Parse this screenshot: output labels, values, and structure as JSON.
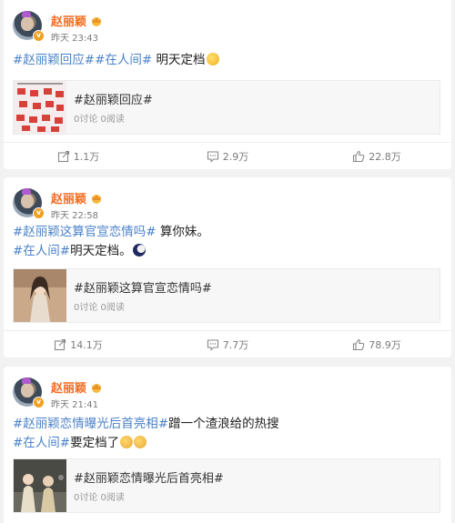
{
  "posts": [
    {
      "username": "赵丽颖",
      "time": "昨天 23:43",
      "lines": [
        [
          {
            "t": "#赵丽颖回应##在人间#",
            "tag": true
          },
          {
            "t": " 明天定档",
            "tag": false
          }
        ]
      ],
      "emoji_end": "yellow",
      "quote": {
        "title": "#赵丽颖回应#",
        "stats": "0讨论 0阅读"
      },
      "actions": {
        "repost": "1.1万",
        "comment": "2.9万",
        "like": "22.8万"
      }
    },
    {
      "username": "赵丽颖",
      "time": "昨天 22:58",
      "lines": [
        [
          {
            "t": "#赵丽颖这算官宣恋情吗#",
            "tag": true
          },
          {
            "t": " 算你妹。",
            "tag": false
          }
        ],
        [
          {
            "t": "#在人间#",
            "tag": true
          },
          {
            "t": "明天定档。",
            "tag": false
          }
        ]
      ],
      "emoji_end": "moon",
      "quote": {
        "title": "#赵丽颖这算官宣恋情吗#",
        "stats": "0讨论 0阅读"
      },
      "actions": {
        "repost": "14.1万",
        "comment": "7.7万",
        "like": "78.9万"
      }
    },
    {
      "username": "赵丽颖",
      "time": "昨天 21:41",
      "lines": [
        [
          {
            "t": "#赵丽颖恋情曝光后首亮相#",
            "tag": true
          },
          {
            "t": "蹭一个渣浪给的热搜",
            "tag": false
          }
        ],
        [
          {
            "t": "#在人间#",
            "tag": true
          },
          {
            "t": "要定档了",
            "tag": false
          }
        ]
      ],
      "emoji_end": "cheer",
      "quote": {
        "title": "#赵丽颖恋情曝光后首亮相#",
        "stats": "0讨论 0阅读"
      },
      "actions": {
        "repost": "",
        "comment": "",
        "like": ""
      }
    }
  ],
  "colors": {
    "username": "#f26b1d",
    "tag": "#4a82c8",
    "background": "#f2f2f2"
  },
  "icons": {
    "repost": "share-icon",
    "comment": "comment-icon",
    "like": "thumbs-up-icon",
    "verified": "verified-badge-icon",
    "vip": "crown-icon"
  }
}
